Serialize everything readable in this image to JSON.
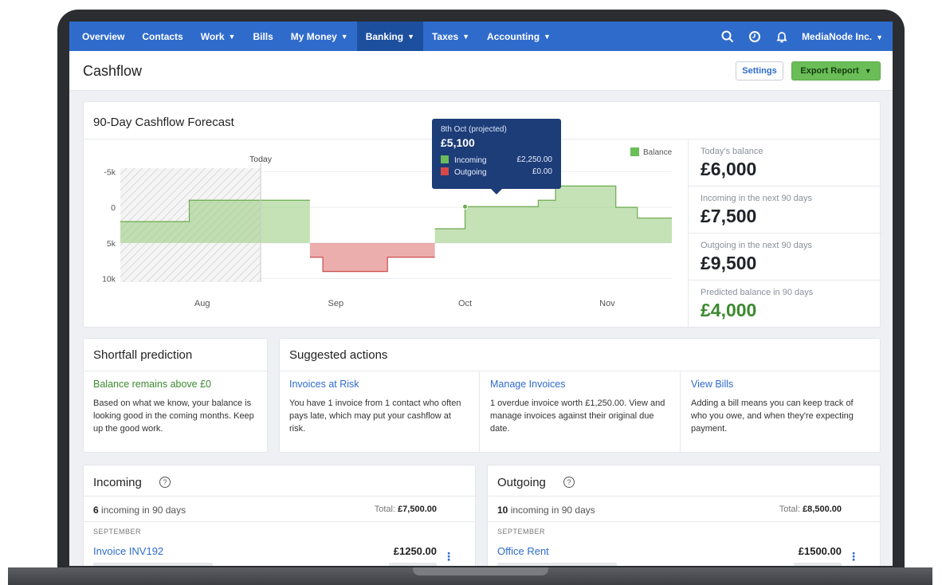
{
  "nav": {
    "items": [
      {
        "label": "Overview",
        "caret": false
      },
      {
        "label": "Contacts",
        "caret": false
      },
      {
        "label": "Work",
        "caret": true
      },
      {
        "label": "Bills",
        "caret": false
      },
      {
        "label": "My Money",
        "caret": true
      },
      {
        "label": "Banking",
        "caret": true,
        "active": true
      },
      {
        "label": "Taxes",
        "caret": true
      },
      {
        "label": "Accounting",
        "caret": true
      }
    ],
    "icons": [
      "search-icon",
      "clock-icon",
      "bell-icon"
    ],
    "org_name": "MediaNode Inc.",
    "accent": "#2f6bcb"
  },
  "page": {
    "title": "Cashflow",
    "settings_label": "Settings",
    "export_label": "Export Report"
  },
  "forecast": {
    "title": "90-Day Cashflow Forecast",
    "today_label": "Today",
    "legend_label": "Balance",
    "y_ticks": [
      "10k",
      "5k",
      "0",
      "-5k"
    ],
    "x_ticks": [
      "Aug",
      "Sep",
      "Oct",
      "Nov"
    ],
    "tooltip": {
      "date": "8th Oct (projected)",
      "amount": "£5,100",
      "incoming_label": "Incoming",
      "incoming_value": "£2,250.00",
      "outgoing_label": "Outgoing",
      "outgoing_value": "£0.00"
    },
    "stats": [
      {
        "label": "Today's balance",
        "value": "£6,000"
      },
      {
        "label": "Incoming in the next 90 days",
        "value": "£7,500"
      },
      {
        "label": "Outgoing in the next 90 days",
        "value": "£9,500"
      },
      {
        "label": "Predicted balance in 90 days",
        "value": "£4,000"
      }
    ]
  },
  "chart_data": {
    "type": "area",
    "title": "90-Day Cashflow Forecast",
    "series": [
      {
        "name": "Balance",
        "values": [
          3000,
          3000,
          6000,
          6000,
          6000,
          6000,
          -2000,
          -4000,
          -4000,
          -2000,
          -2000,
          2000,
          2000,
          5100,
          5100,
          6000,
          8000,
          8000,
          5000,
          3500,
          3500
        ]
      }
    ],
    "x": [
      "Jul 20",
      "Jul 29",
      "Aug 5",
      "Aug 20",
      "Aug 29",
      "Sep 1",
      "Sep 2",
      "Sep 5",
      "Sep 16",
      "Sep 20",
      "Sep 30",
      "Oct 1",
      "Oct 7",
      "Oct 8",
      "Oct 22",
      "Oct 25",
      "Oct 29",
      "Nov 10",
      "Nov 12",
      "Nov 17",
      "Nov 25"
    ],
    "x_ticks": [
      "Aug",
      "Sep",
      "Oct",
      "Nov"
    ],
    "ylim": [
      -5500,
      10500
    ],
    "y_ticks": [
      -5000,
      0,
      5000,
      10000
    ],
    "annotations": [
      "Today"
    ],
    "colors": {
      "positive": "#9dce84",
      "negative": "#e07777",
      "line": "#6dab4f"
    },
    "legend": "top-right"
  },
  "shortfall": {
    "title": "Shortfall prediction",
    "status": "Balance remains above £0",
    "text": "Based on what we know, your balance is looking good in the coming months. Keep up the good work."
  },
  "suggested": {
    "title": "Suggested actions",
    "actions": [
      {
        "title": "Invoices at Risk",
        "text": "You have 1 invoice from 1 contact who often pays late, which may put your cashflow at risk."
      },
      {
        "title": "Manage Invoices",
        "text": "1 overdue invoice worth £1,250.00. View and manage invoices against their original due date."
      },
      {
        "title": "View Bills",
        "text": "Adding a bill means you can keep track of who you owe, and when they're expecting payment."
      }
    ]
  },
  "incoming": {
    "title": "Incoming",
    "count_num": "6",
    "count_text": "incoming in 90 days",
    "total_label": "Total:",
    "total_value": "£7,500.00",
    "month": "SEPTEMBER",
    "item_name": "Invoice INV192",
    "item_amount": "£1250.00"
  },
  "outgoing": {
    "title": "Outgoing",
    "count_num": "10",
    "count_text": "incoming in 90 days",
    "total_label": "Total:",
    "total_value": "£8,500.00",
    "month": "SEPTEMBER",
    "item_name": "Office Rent",
    "item_amount": "£1500.00"
  }
}
